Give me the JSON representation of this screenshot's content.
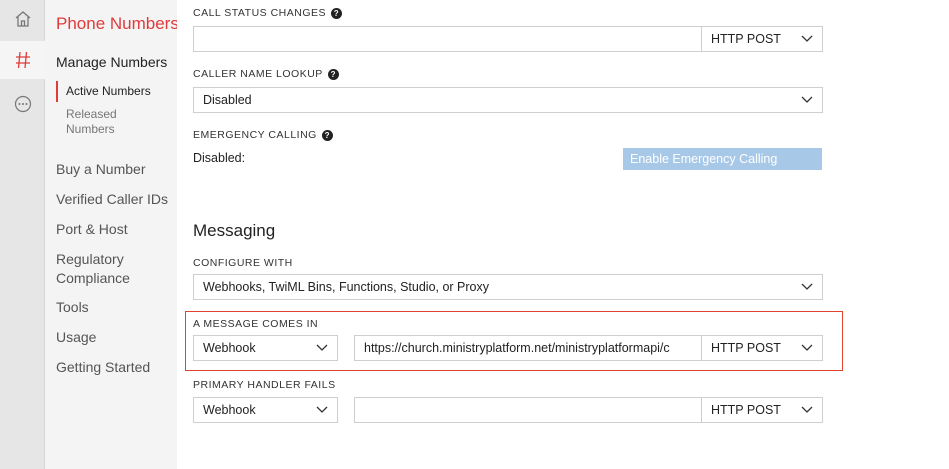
{
  "rail": {
    "icons": [
      "home-icon",
      "hash-icon",
      "more-icon"
    ]
  },
  "nav": {
    "title": "Phone Numbers",
    "section": "Manage Numbers",
    "sub_items": [
      {
        "label": "Active Numbers"
      },
      {
        "label": "Released Numbers"
      }
    ],
    "items": [
      {
        "label": "Buy a Number"
      },
      {
        "label": "Verified Caller IDs"
      },
      {
        "label": "Port & Host"
      },
      {
        "label": "Regulatory Compliance"
      },
      {
        "label": "Tools"
      },
      {
        "label": "Usage"
      },
      {
        "label": "Getting Started"
      }
    ]
  },
  "voice": {
    "call_status": {
      "label": "CALL STATUS CHANGES",
      "url_value": "",
      "method": "HTTP POST"
    },
    "caller_name": {
      "label": "CALLER NAME LOOKUP",
      "value": "Disabled"
    },
    "emergency": {
      "label": "EMERGENCY CALLING",
      "status": "Disabled:",
      "button": "Enable Emergency Calling"
    }
  },
  "messaging": {
    "heading": "Messaging",
    "configure": {
      "label": "CONFIGURE WITH",
      "value": "Webhooks, TwiML Bins, Functions, Studio, or Proxy"
    },
    "message_in": {
      "label": "A MESSAGE COMES IN",
      "type": "Webhook",
      "url": "https://church.ministryplatform.net/ministryplatformapi/c",
      "method": "HTTP POST"
    },
    "handler_fails": {
      "label": "PRIMARY HANDLER FAILS",
      "type": "Webhook",
      "url": "",
      "method": "HTTP POST"
    }
  },
  "colors": {
    "accent": "#e03a3a",
    "highlight": "#e0442e",
    "disabled_button": "#a8c8e8"
  }
}
